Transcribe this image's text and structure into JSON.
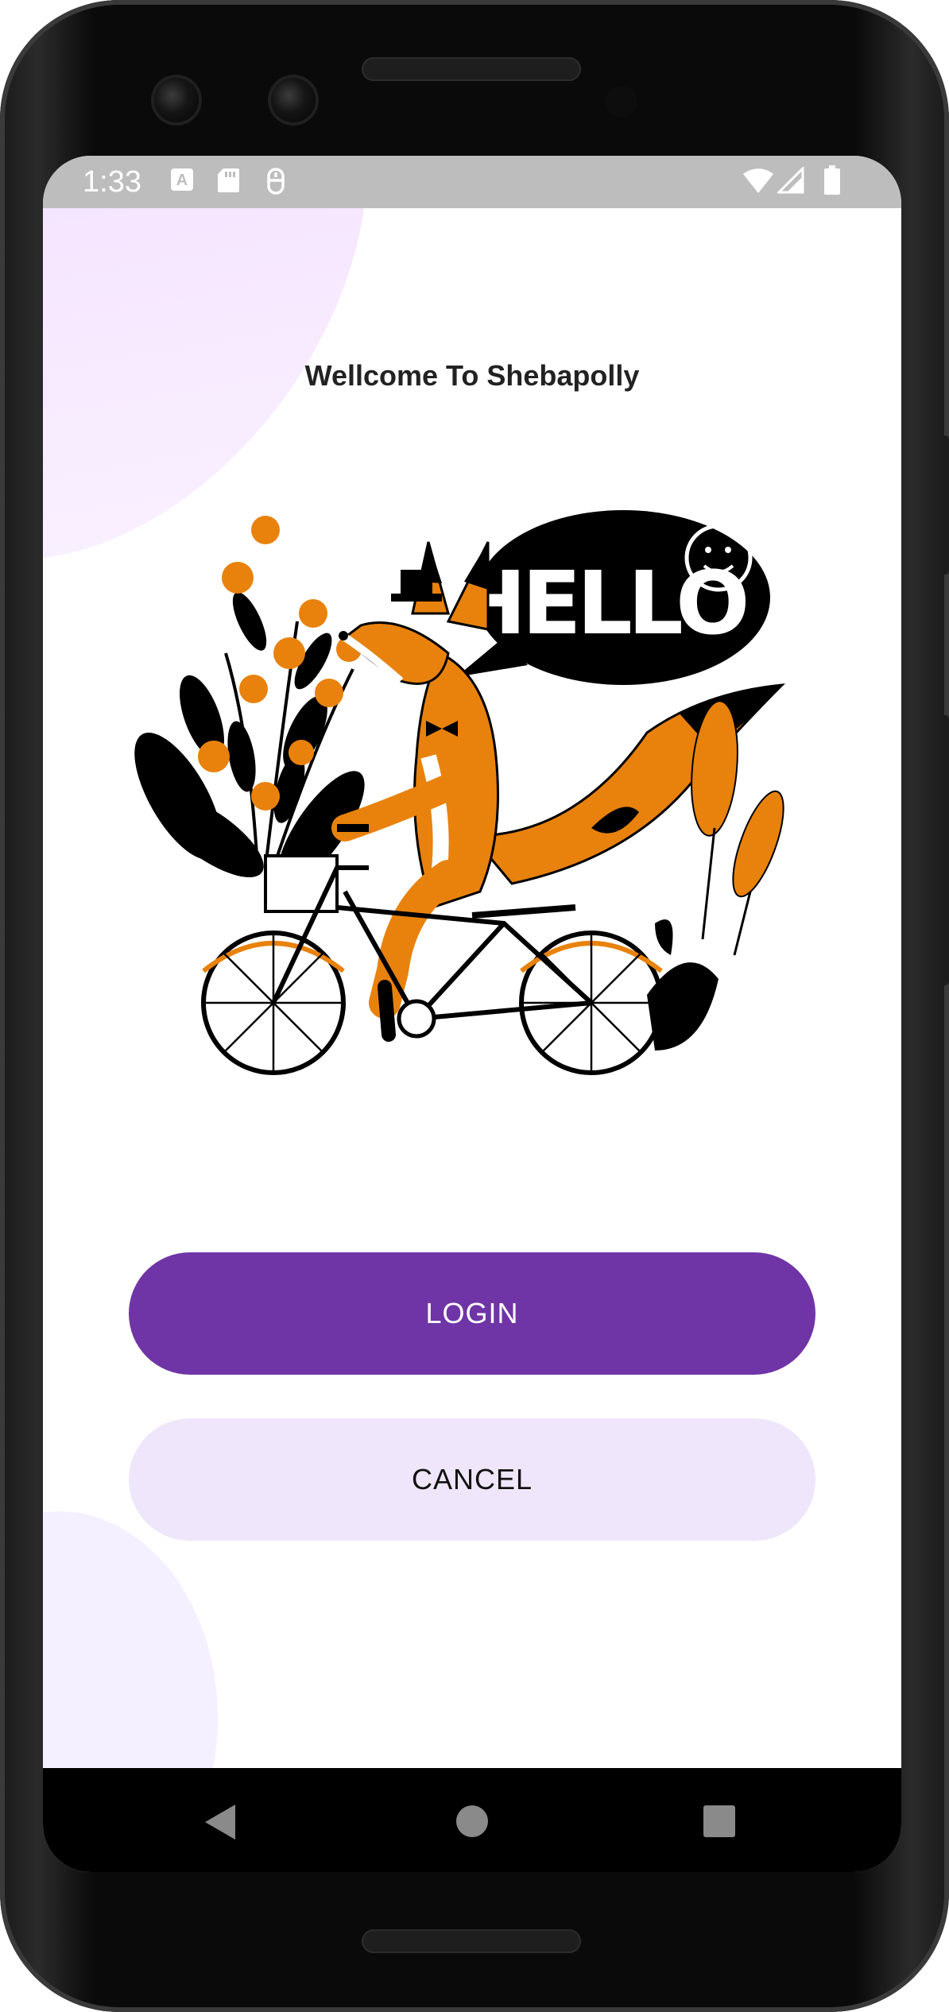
{
  "status_bar": {
    "time": "1:33",
    "icons": [
      "a-notification-icon",
      "sd-card-icon",
      "accessibility-icon",
      "wifi-icon",
      "signal-icon",
      "battery-icon"
    ]
  },
  "welcome": {
    "title": "Wellcome To Shebapolly",
    "speech_bubble_text": "HELLO"
  },
  "actions": {
    "login_label": "LOGIN",
    "cancel_label": "CANCEL"
  },
  "navigation": {
    "back": "back-icon",
    "home": "home-icon",
    "recents": "recents-icon"
  },
  "colors": {
    "primary": "#6f35a6",
    "secondary_button": "#efe6fb",
    "accent_orange": "#e8820c",
    "status_bar": "#bdbdbd"
  }
}
